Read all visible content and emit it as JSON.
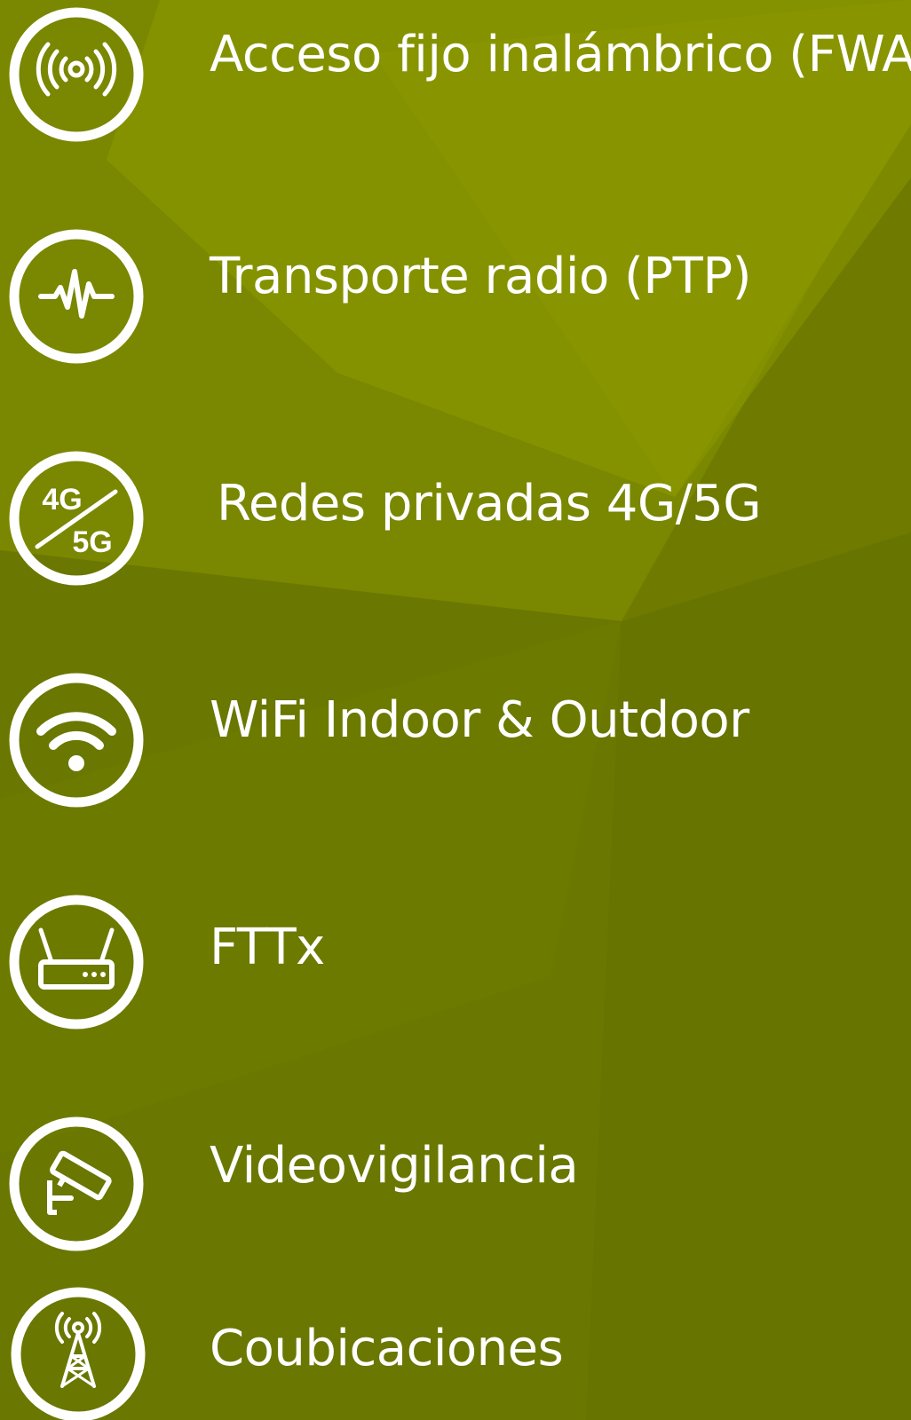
{
  "colors": {
    "background": "#6f7c00",
    "highlight": "#889400",
    "foreground": "#ffffff"
  },
  "items": [
    {
      "label": "Acceso fijo inalámbrico (FWA)",
      "icon": "wireless-broadcast-icon"
    },
    {
      "label": "Transporte radio (PTP)",
      "icon": "signal-wave-icon"
    },
    {
      "label": "Redes privadas 4G/5G",
      "icon": "4g-5g-icon"
    },
    {
      "label": "WiFi Indoor & Outdoor",
      "icon": "wifi-icon"
    },
    {
      "label": "FTTx",
      "icon": "router-icon"
    },
    {
      "label": "Videovigilancia",
      "icon": "security-camera-icon"
    },
    {
      "label": "Coubicaciones",
      "icon": "antenna-tower-icon"
    }
  ],
  "icon_text": {
    "top": "4G",
    "bottom": "5G"
  }
}
